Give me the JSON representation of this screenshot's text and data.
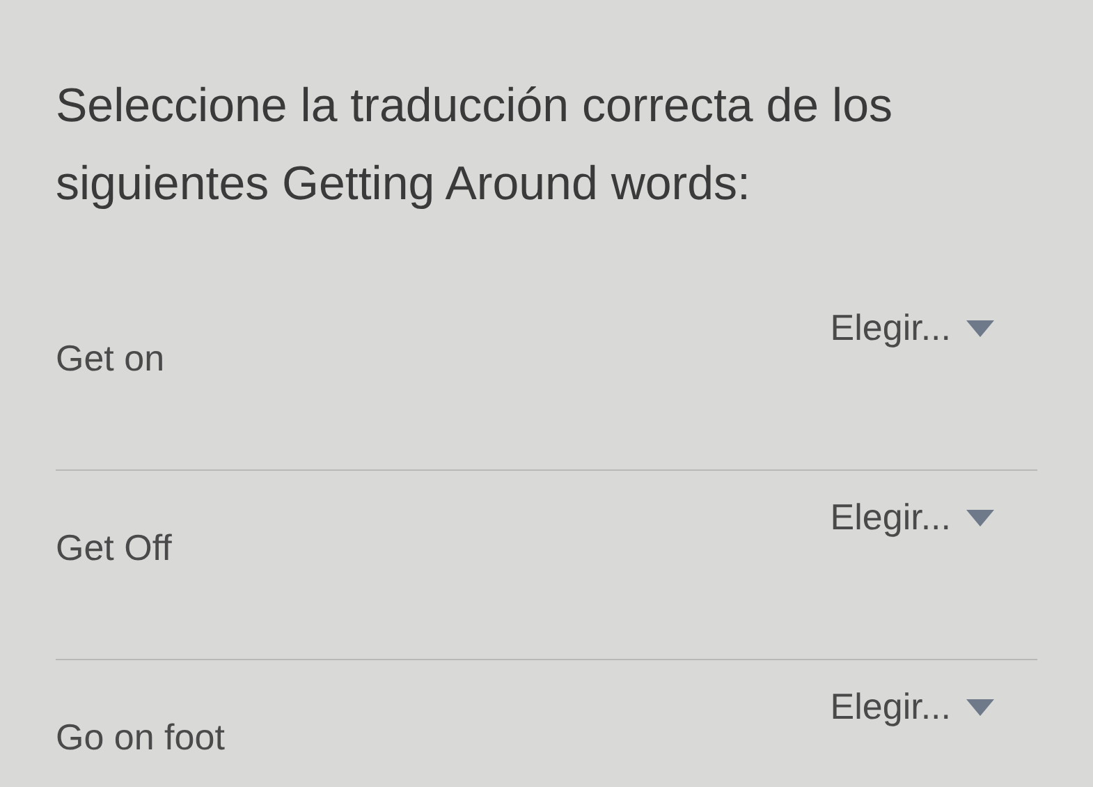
{
  "question": {
    "prompt": "Seleccione la traducción correcta de los siguientes Getting Around words:"
  },
  "items": [
    {
      "term": "Get on",
      "choice": "Elegir..."
    },
    {
      "term": "Get Off",
      "choice": "Elegir..."
    },
    {
      "term": "Go on foot",
      "choice": "Elegir..."
    }
  ]
}
